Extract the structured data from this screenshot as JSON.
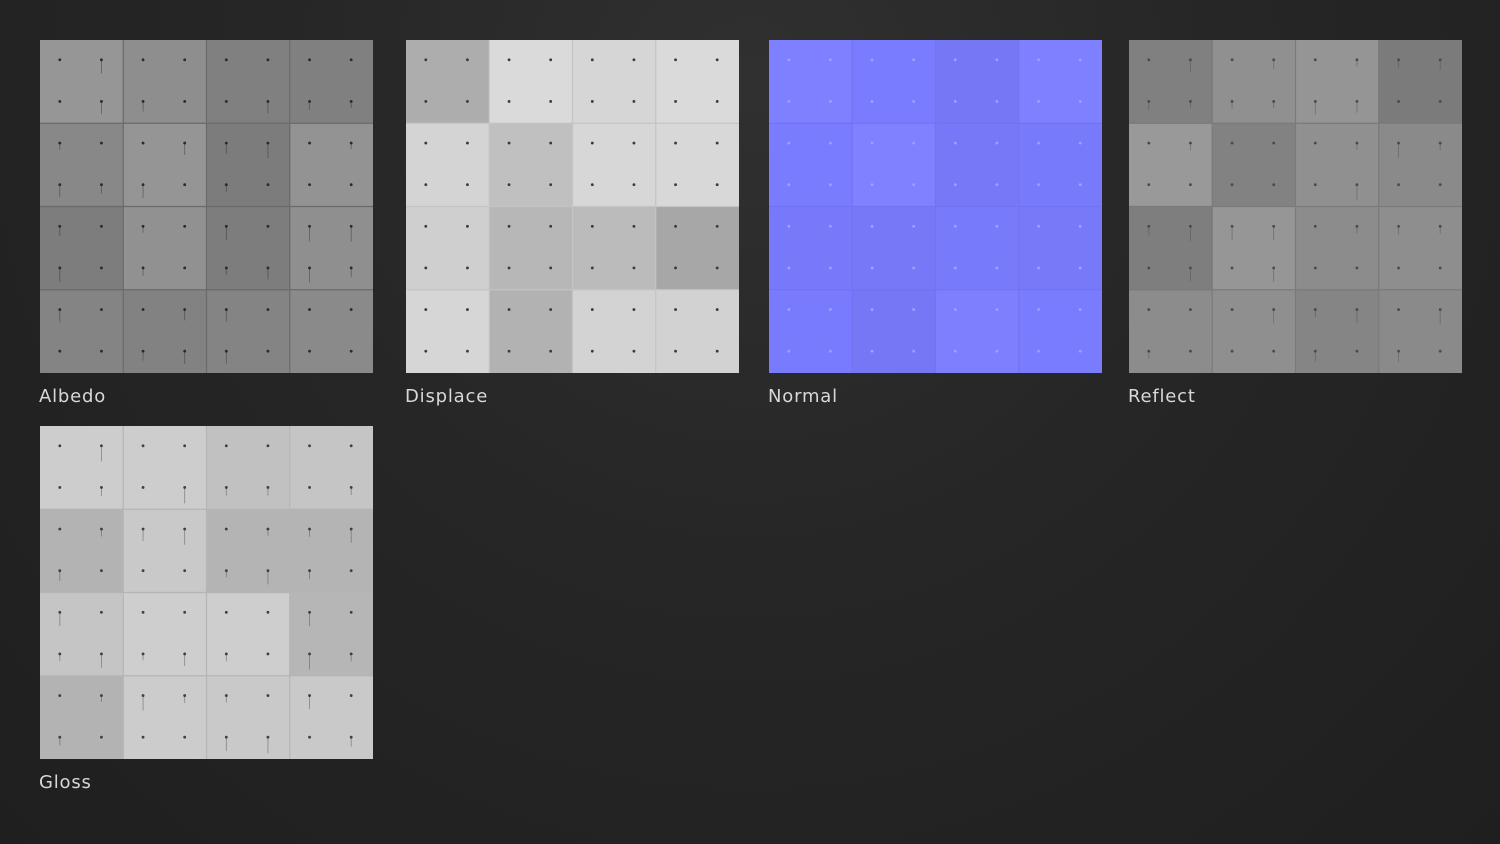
{
  "maps": [
    {
      "id": "albedo",
      "label": "Albedo",
      "base_color": "#8a8a8a",
      "seam_color": "#6a6a6a",
      "dot_color": "#2a2a2a"
    },
    {
      "id": "displace",
      "label": "Displace",
      "base_color": "#d4d4d4",
      "seam_color": "#c4c4c4",
      "dot_color": "#3a3a3a"
    },
    {
      "id": "normal",
      "label": "Normal",
      "base_color": "#7a7cff",
      "seam_color": "#7174f0",
      "dot_color": "#9fa1ff"
    },
    {
      "id": "reflect",
      "label": "Reflect",
      "base_color": "#8c8c8c",
      "seam_color": "#7a7a7a",
      "dot_color": "#4a4a4a"
    },
    {
      "id": "gloss",
      "label": "Gloss",
      "base_color": "#c9c9c9",
      "seam_color": "#b5b5b5",
      "dot_color": "#3f3f3f"
    }
  ],
  "grid": {
    "panels": 4,
    "dots_per_panel": 2
  }
}
